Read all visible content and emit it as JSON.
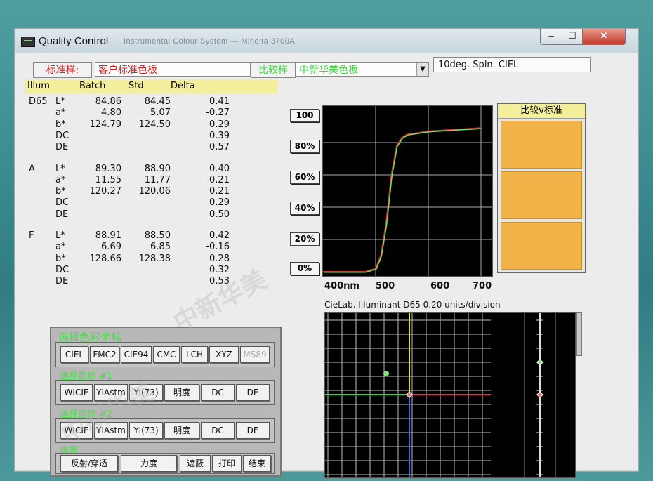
{
  "window": {
    "title": "Quality Control",
    "subtitle": "Instrumental Colour System — Minolta 3700A",
    "min_label": "–",
    "max_label": "☐",
    "close_label": "✕"
  },
  "header": {
    "standard_label": "标准样:",
    "standard_value": "客户标准色板",
    "compare_label": "比较样",
    "compare_value": "中新华美色板",
    "illuminant_field": "10deg. Spln. CIEL"
  },
  "table": {
    "headers": [
      "Illum",
      "Batch",
      "Std",
      "Delta"
    ],
    "groups": [
      {
        "illum": "D65",
        "rows": [
          {
            "param": "L*",
            "batch": "84.86",
            "std": "84.45",
            "delta": "0.41"
          },
          {
            "param": "a*",
            "batch": "4.80",
            "std": "5.07",
            "delta": "-0.27"
          },
          {
            "param": "b*",
            "batch": "124.79",
            "std": "124.50",
            "delta": "0.29"
          },
          {
            "param": "DC",
            "batch": "",
            "std": "",
            "delta": "0.39"
          },
          {
            "param": "DE",
            "batch": "",
            "std": "",
            "delta": "0.57"
          }
        ]
      },
      {
        "illum": "A",
        "rows": [
          {
            "param": "L*",
            "batch": "89.30",
            "std": "88.90",
            "delta": "0.40"
          },
          {
            "param": "a*",
            "batch": "11.55",
            "std": "11.77",
            "delta": "-0.21"
          },
          {
            "param": "b*",
            "batch": "120.27",
            "std": "120.06",
            "delta": "0.21"
          },
          {
            "param": "DC",
            "batch": "",
            "std": "",
            "delta": "0.29"
          },
          {
            "param": "DE",
            "batch": "",
            "std": "",
            "delta": "0.50"
          }
        ]
      },
      {
        "illum": "F",
        "rows": [
          {
            "param": "L*",
            "batch": "88.91",
            "std": "88.50",
            "delta": "0.42"
          },
          {
            "param": "a*",
            "batch": "6.69",
            "std": "6.85",
            "delta": "-0.16"
          },
          {
            "param": "b*",
            "batch": "128.66",
            "std": "128.38",
            "delta": "0.28"
          },
          {
            "param": "DC",
            "batch": "",
            "std": "",
            "delta": "0.32"
          },
          {
            "param": "DE",
            "batch": "",
            "std": "",
            "delta": "0.53"
          }
        ]
      }
    ]
  },
  "spectral_chart": {
    "y_buttons": [
      "100",
      "80%",
      "60%",
      "40%",
      "20%",
      "0%"
    ],
    "x_labels": [
      "400nm",
      "500",
      "600",
      "700"
    ],
    "series_std_color": "#d23a2a",
    "series_batch_color": "#6fe06f",
    "wavelengths": [
      400,
      480,
      500,
      510,
      520,
      530,
      540,
      550,
      560,
      580,
      600,
      650,
      700
    ],
    "reflectance": [
      0,
      0,
      2,
      10,
      30,
      60,
      78,
      83,
      85,
      86,
      87,
      88,
      89
    ]
  },
  "cie_plot": {
    "caption": "CieLab. Illuminant D65   0.20 units/division",
    "axis_a_color": "#e23b3b",
    "axis_b_color": "#e6e23b",
    "axis_neg_a_color": "#3bd23b",
    "axis_neg_b_color": "#3b6ee6"
  },
  "compare_panel": {
    "title": "比较v标准",
    "swatch_color": "#f2b349"
  },
  "controls": {
    "color_space_title": "选择色彩坐标",
    "color_spaces": [
      "CIEL",
      "FMC2",
      "CIE94",
      "CMC",
      "LCH",
      "XYZ",
      "MS89"
    ],
    "index1_title": "选择指标 #1",
    "index1": [
      "WICIE",
      "YIAstm",
      "YI(73)",
      "明度",
      "DC",
      "DE"
    ],
    "index2_title": "选择指标 #2",
    "index2": [
      "WICIE",
      "YIAstm",
      "YI(73)",
      "明度",
      "DC",
      "DE"
    ],
    "options_title": "选项",
    "options": [
      "反射/穿透",
      "力度",
      "遮蔽",
      "打印",
      "结束"
    ]
  },
  "watermark": "中新华美"
}
